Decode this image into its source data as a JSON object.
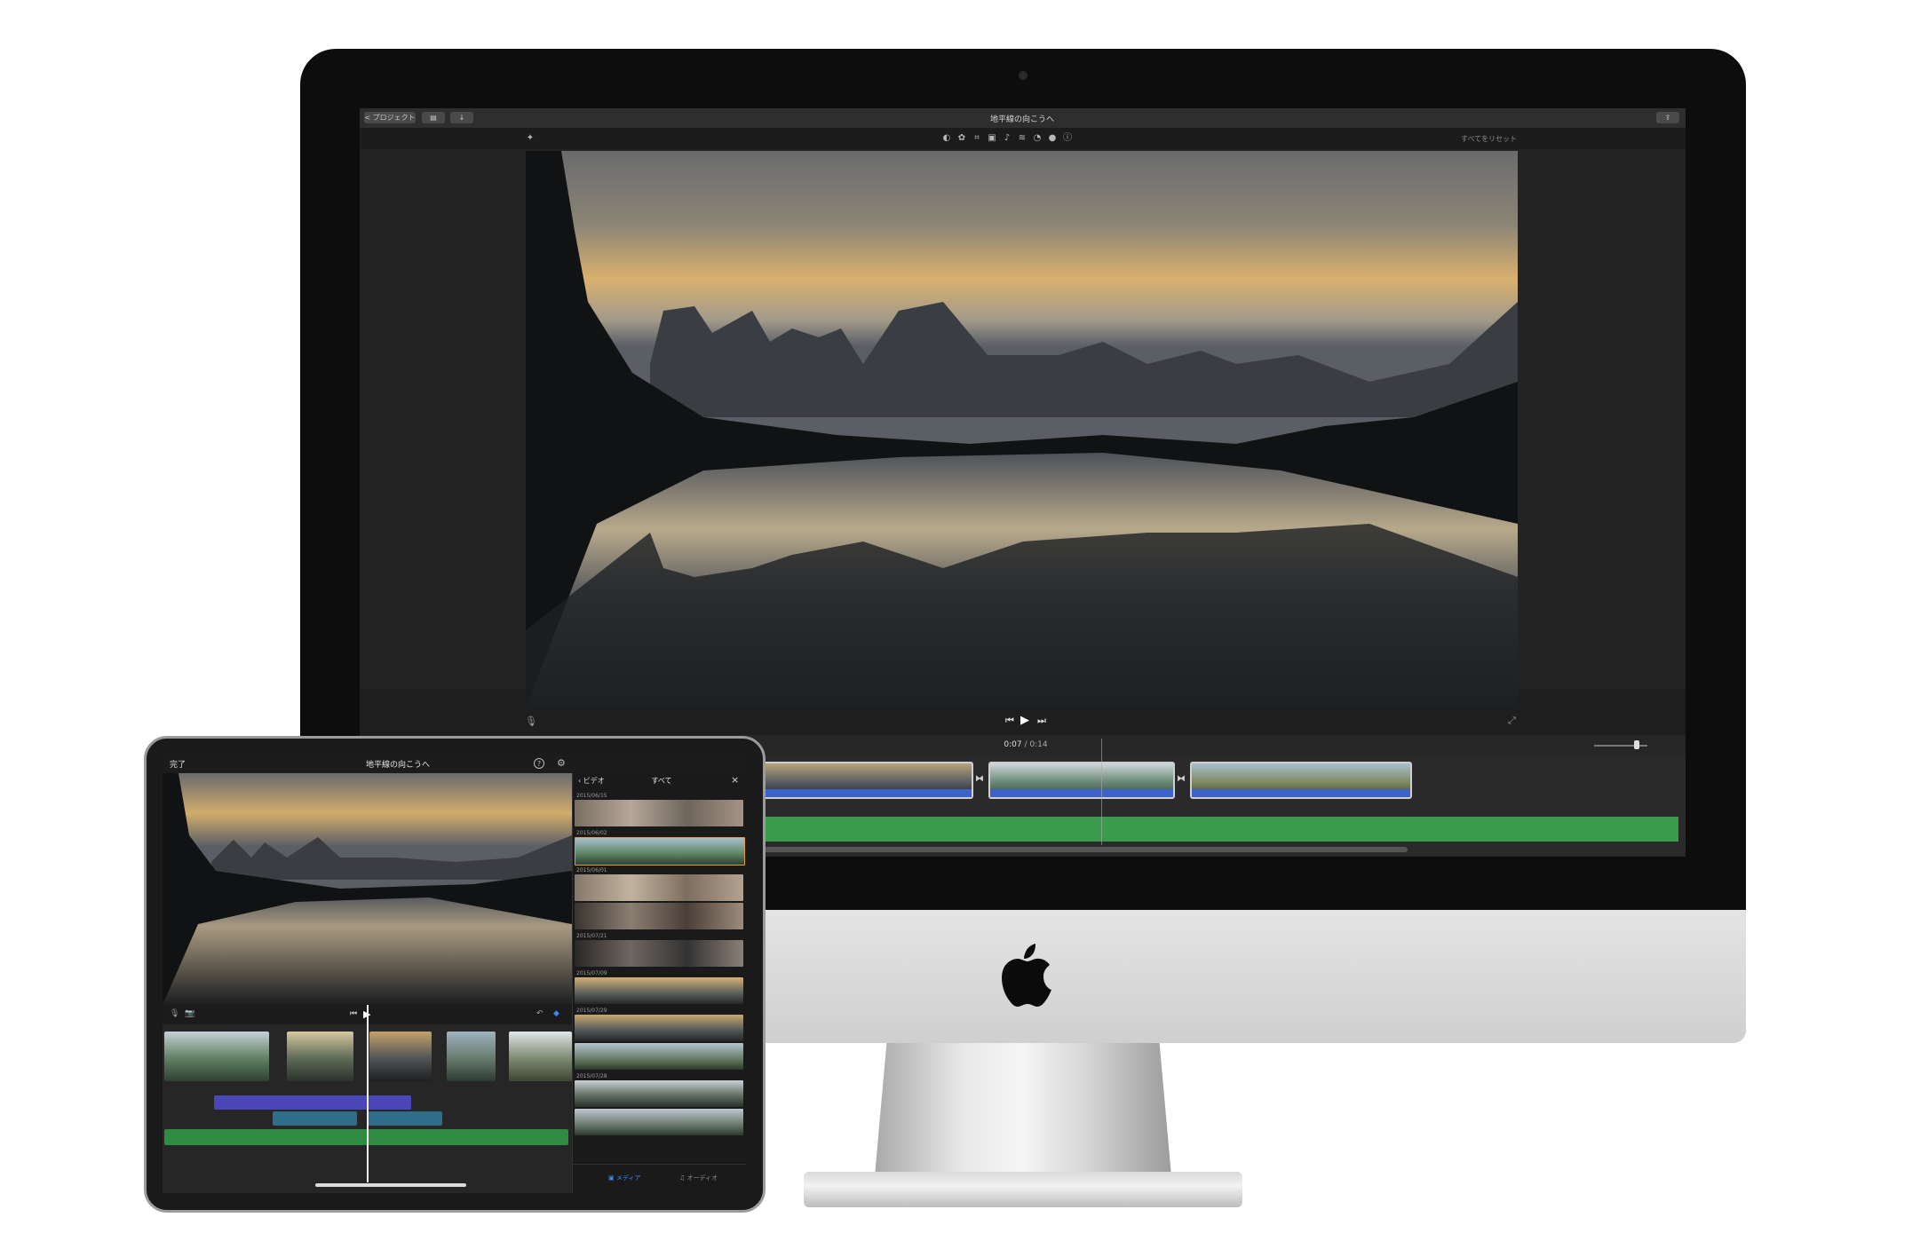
{
  "imac": {
    "toolbar": {
      "projects_label": "< プロジェクト",
      "title": "地平線の向こうへ",
      "reset_all": "すべてをリセット"
    },
    "timecode": {
      "current": "0:07",
      "separator": "/",
      "total": "0:14"
    },
    "adjust_icons": [
      "color-balance-icon",
      "color-correction-icon",
      "crop-icon",
      "stabilization-icon",
      "volume-icon",
      "noise-reduction-icon",
      "speed-icon",
      "filter-icon",
      "info-icon"
    ]
  },
  "ipad": {
    "done_label": "完了",
    "title": "地平線の向こうへ",
    "browser": {
      "back_label": "ビデオ",
      "all_label": "すべて",
      "dates": [
        "2015/06/15",
        "2015/06/02",
        "2015/06/01",
        "2015/07/21",
        "2015/07/09",
        "2015/07/29",
        "2015/07/28"
      ],
      "tabs": {
        "media": "メディア",
        "audio": "オーディオ"
      }
    }
  },
  "colors": {
    "audio_blue": "#3d62c9",
    "music_green": "#3a9b4c",
    "accent_blue": "#3c8bf2"
  }
}
